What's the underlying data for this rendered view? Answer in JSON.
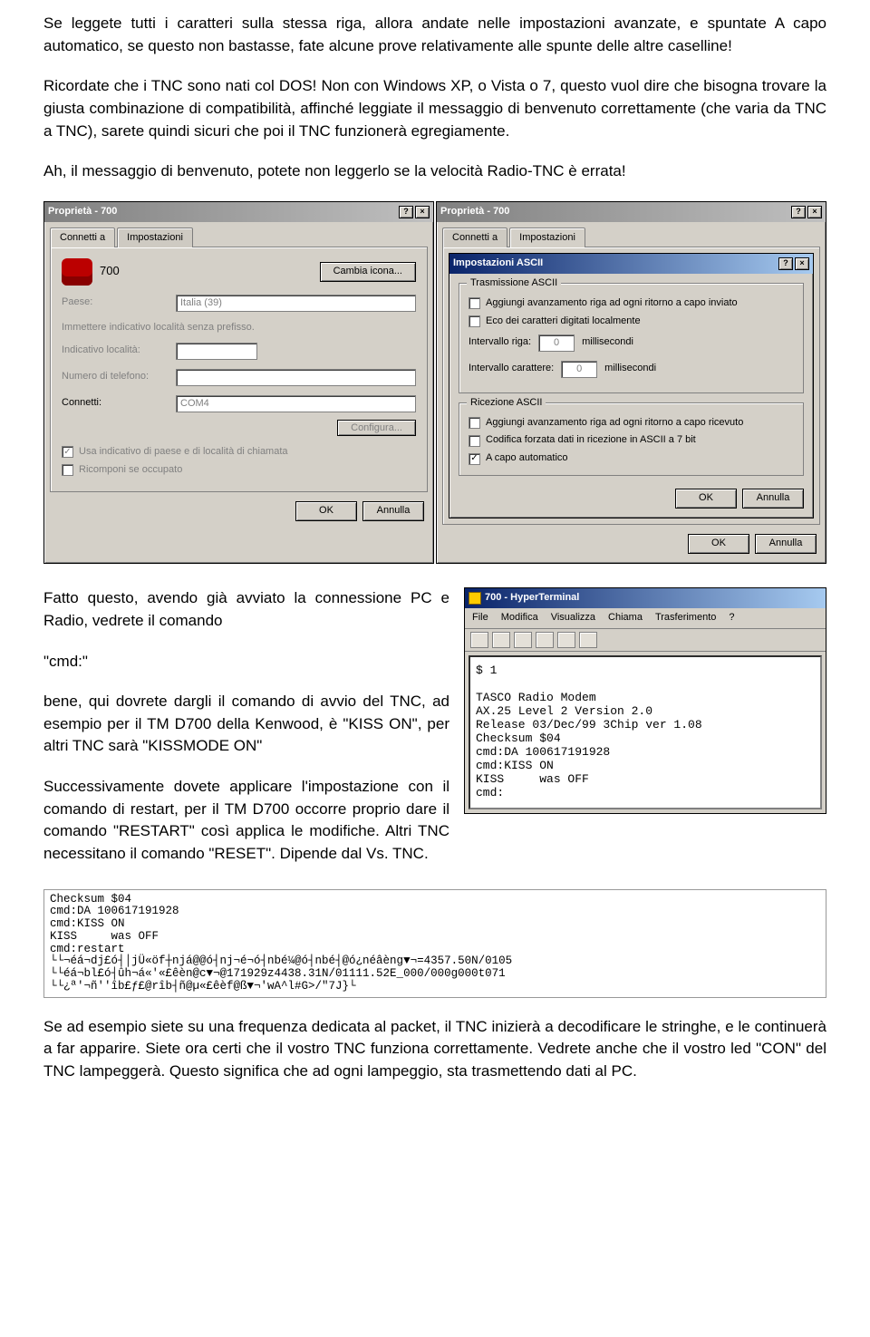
{
  "para1": "Se leggete tutti i caratteri sulla stessa riga, allora andate nelle impostazioni avanzate, e spuntate A capo automatico, se questo non bastasse, fate alcune prove relativamente alle spunte delle altre caselline!",
  "para2": "Ricordate che i TNC sono nati col DOS! Non con Windows XP, o Vista o 7, questo vuol dire che bisogna trovare la giusta combinazione di compatibilità, affinché leggiate il messaggio di benvenuto correttamente (che varia da TNC a TNC), sarete quindi sicuri che poi il TNC funzionerà egregiamente.",
  "para3": "Ah, il messaggio di benvenuto, potete non leggerlo se la velocità Radio-TNC è errata!",
  "dlg1": {
    "title": "Proprietà - 700",
    "tab1": "Connetti a",
    "tab2": "Impostazioni",
    "conn_name": "700",
    "change_icon": "Cambia icona...",
    "country_lbl": "Paese:",
    "country_val": "Italia (39)",
    "prefix_note": "Immettere indicativo località senza prefisso.",
    "area_lbl": "Indicativo località:",
    "phone_lbl": "Numero di telefono:",
    "connect_lbl": "Connetti:",
    "connect_val": "COM4",
    "configure": "Configura...",
    "use_area": "Usa indicativo di paese e di località di chiamata",
    "redial": "Ricomponi se occupato",
    "ok": "OK",
    "cancel": "Annulla"
  },
  "dlg2": {
    "title": "Proprietà - 700",
    "tab1": "Connetti a",
    "tab2": "Impostazioni",
    "inner_title": "Impostazioni ASCII",
    "group_tx": "Trasmissione ASCII",
    "tx_opt1": "Aggiungi avanzamento riga ad ogni ritorno a capo inviato",
    "tx_opt2": "Eco dei caratteri digitati localmente",
    "row_lbl": "Intervallo riga:",
    "row_val": "0",
    "char_lbl": "Intervallo carattere:",
    "char_val": "0",
    "ms": "millisecondi",
    "group_rx": "Ricezione ASCII",
    "rx_opt1": "Aggiungi avanzamento riga ad ogni ritorno a capo ricevuto",
    "rx_opt2": "Codifica forzata dati in ricezione in ASCII a 7 bit",
    "rx_opt3": "A capo automatico",
    "ok": "OK",
    "cancel": "Annulla"
  },
  "mid1": "Fatto questo, avendo già avviato la connessione PC e Radio, vedrete il comando",
  "mid2": "\"cmd:\"",
  "mid3": "bene, qui dovrete dargli il comando di avvio del TNC, ad esempio per il TM D700 della Kenwood, è \"KISS ON\", per altri TNC sarà \"KISSMODE ON\"",
  "mid4": "Successivamente dovete applicare l'impostazione con il comando di restart, per il TM D700 occorre proprio dare il comando \"RESTART\" così applica le modifiche. Altri TNC necessitano il comando \"RESET\". Dipende dal Vs. TNC.",
  "hyper": {
    "title": "700 - HyperTerminal",
    "menu": [
      "File",
      "Modifica",
      "Visualizza",
      "Chiama",
      "Trasferimento",
      "?"
    ],
    "term": "$ 1\n\nTASCO Radio Modem\nAX.25 Level 2 Version 2.0\nRelease 03/Dec/99 3Chip ver 1.08\nChecksum $04\ncmd:DA 100617191928\ncmd:KISS ON\nKISS     was OFF\ncmd:"
  },
  "term2": "Checksum $04\ncmd:DA 100617191928\ncmd:KISS ON\nKISS     was OFF\ncmd:restart\n└└¬éá¬dj£ó┤│jÜ«öf┼njá@@ó┤nj¬é¬ó┤nbé¼@ó┤nbé┤@ó¿néâèng▼¬=4357.50N/0105\n└└éá¬bl£ó┤ûh¬á«'«£êèn@c▼¬@171929z4438.31N/01111.52E_000/000g000t071\n└└¿ª'¬ñ''îb£ƒ£@rîb┤ñ@µ«£êèf@ß▼¬'wA^l#G>/\"7J}└",
  "last": "Se ad esempio siete su una frequenza dedicata al packet, il TNC inizierà a decodificare le stringhe, e le continuerà a far apparire. Siete ora certi che il vostro TNC funziona correttamente. Vedrete anche che il vostro led \"CON\" del TNC lampeggerà. Questo significa che ad ogni lampeggio, sta trasmettendo dati al PC."
}
